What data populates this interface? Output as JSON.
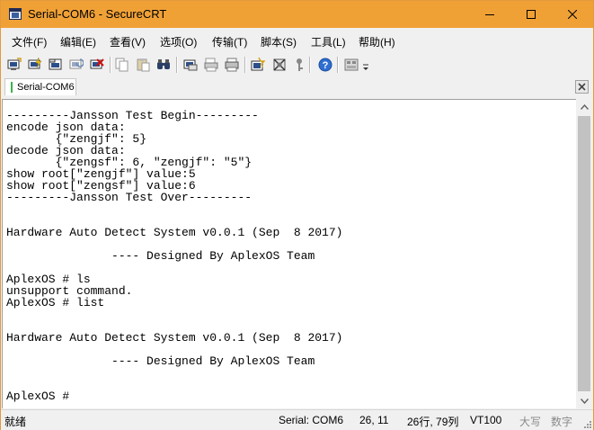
{
  "window": {
    "title": "Serial-COM6 - SecureCRT"
  },
  "menu": {
    "items": [
      {
        "label": "文件(F)"
      },
      {
        "label": "编辑(E)"
      },
      {
        "label": "查看(V)"
      },
      {
        "label": "选项(O)"
      },
      {
        "label": "传输(T)"
      },
      {
        "label": "脚本(S)"
      },
      {
        "label": "工具(L)"
      },
      {
        "label": "帮助(H)"
      }
    ]
  },
  "toolbar": {
    "icons": [
      "connect-icon",
      "quick-connect-icon",
      "connect-in-tab-icon",
      "reconnect-icon",
      "disconnect-icon",
      "copy-icon",
      "paste-icon",
      "find-icon",
      "print-icon",
      "print-selection-icon",
      "print-setup-icon",
      "session-options-icon",
      "global-options-icon",
      "keymap-icon",
      "help-icon",
      "sftp-icon",
      "dropdown-icon"
    ]
  },
  "tabs": [
    {
      "label": "Serial-COM6",
      "active": true,
      "indicator_color": "#39b54a"
    }
  ],
  "terminal": {
    "lines": [
      "---------Jansson Test Begin---------",
      "encode json data:",
      "       {\"zengjf\": 5}",
      "decode json data:",
      "       {\"zengsf\": 6, \"zengjf\": \"5\"}",
      "show root[\"zengjf\"] value:5",
      "show root[\"zengsf\"] value:6",
      "---------Jansson Test Over---------",
      "",
      "",
      "Hardware Auto Detect System v0.0.1 (Sep  8 2017)",
      "",
      "               ---- Designed By AplexOS Team",
      "",
      "AplexOS # ls",
      "unsupport command.",
      "AplexOS # list",
      "",
      "",
      "Hardware Auto Detect System v0.0.1 (Sep  8 2017)",
      "",
      "               ---- Designed By AplexOS Team",
      "",
      "",
      "AplexOS # "
    ]
  },
  "status": {
    "ready": "就绪",
    "session": "Serial: COM6",
    "cursor_pos": "26,  11",
    "dimensions": "26行, 79列",
    "emulation": "VT100",
    "caps": "大写",
    "num": "数字"
  },
  "colors": {
    "titlebar": "#f0a136",
    "window_border": "#e39a3e",
    "chrome": "#f0f0f0",
    "terminal_bg": "#ffffff",
    "terminal_fg": "#000000",
    "scroll_thumb": "#c2c2c2"
  }
}
